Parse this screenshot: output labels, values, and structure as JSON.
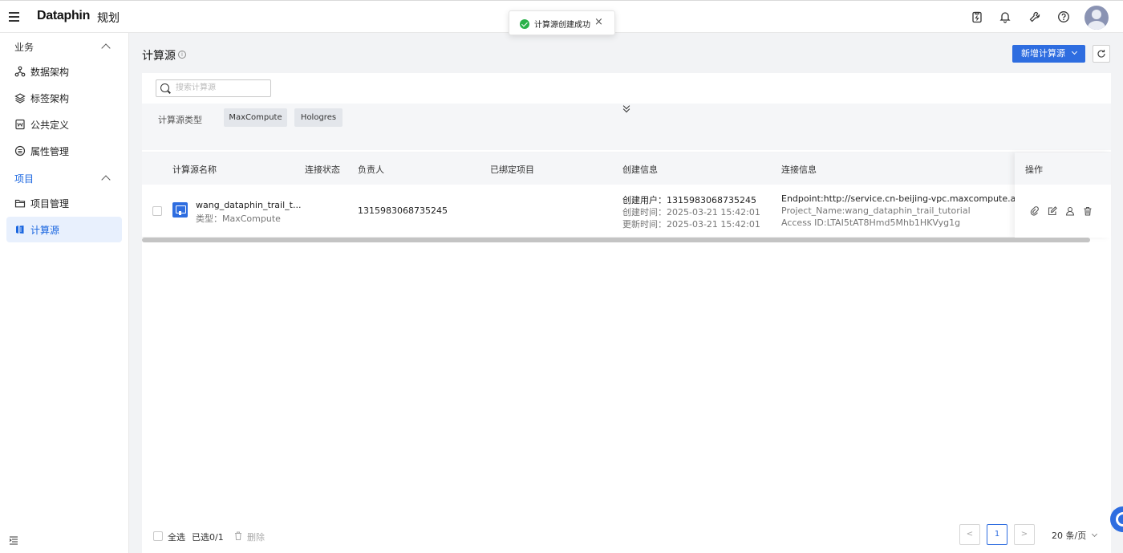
{
  "app": {
    "logo": "Dataphin",
    "module": "规划"
  },
  "toast": {
    "message": "计算源创建成功"
  },
  "sidebar": {
    "groups": [
      {
        "label": "业务",
        "items": [
          {
            "label": "数据架构",
            "icon": "architecture-icon"
          },
          {
            "label": "标签架构",
            "icon": "layers-icon"
          },
          {
            "label": "公共定义",
            "icon": "word-doc-icon"
          },
          {
            "label": "属性管理",
            "icon": "list-circle-icon"
          }
        ]
      },
      {
        "label": "项目",
        "items": [
          {
            "label": "项目管理",
            "icon": "folder-icon"
          },
          {
            "label": "计算源",
            "icon": "compute-source-icon",
            "active": true
          }
        ]
      }
    ]
  },
  "page": {
    "title": "计算源",
    "new_button": "新增计算源",
    "search_placeholder": "搜索计算源",
    "filter": {
      "label": "计算源类型",
      "options": [
        "MaxCompute",
        "Hologres"
      ]
    }
  },
  "table": {
    "columns": [
      "计算源名称",
      "连接状态",
      "负责人",
      "已绑定项目",
      "创建信息",
      "连接信息",
      "操作"
    ],
    "rows": [
      {
        "name": "wang_dataphin_trail_t...",
        "type_line": "类型：MaxCompute",
        "status": "",
        "owner": "1315983068735245",
        "bound_projects": "",
        "created_user": "创建用户：1315983068735245",
        "created_time": "创建时间：2025-03-21 15:42:01",
        "updated_time": "更新时间：2025-03-21 15:42:01",
        "endpoint": "Endpoint:http://service.cn-beijing-vpc.maxcompute.aliyun-inc.com/a",
        "project_name": "Project_Name:wang_dataphin_trail_tutorial",
        "access_id": "Access ID:LTAI5tAT8Hmd5Mhb1HKVyg1g"
      }
    ]
  },
  "footer": {
    "select_all": "全选",
    "selected": "已选0/1",
    "delete": "删除",
    "page": "1",
    "page_size": "20 条/页"
  },
  "colors": {
    "primary": "#2e6de0",
    "success": "#2bb14a"
  }
}
